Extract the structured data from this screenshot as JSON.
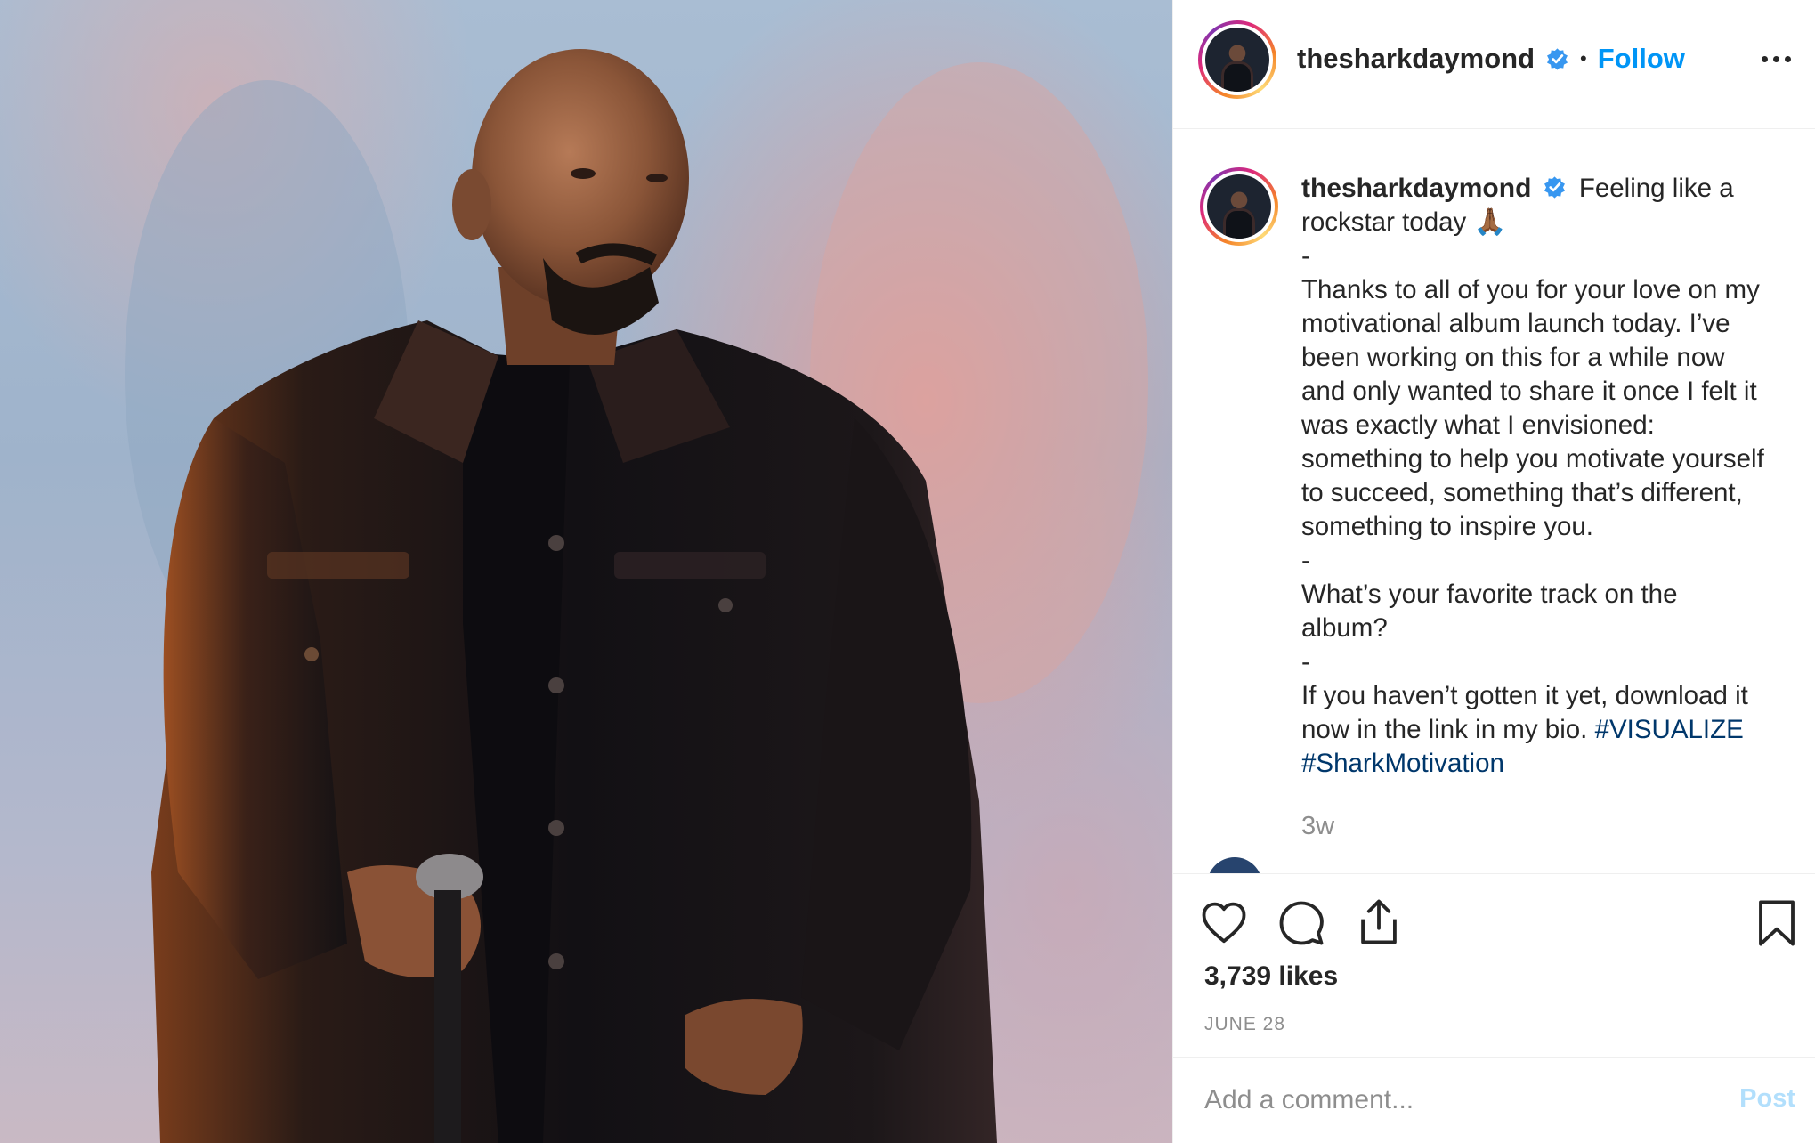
{
  "post": {
    "username": "thesharkdaymond",
    "separator": "•",
    "follow_label": "Follow",
    "caption": {
      "lines": [
        "Feeling like a",
        "rockstar today 🙏🏾",
        "-",
        "Thanks to all of you for your love on my",
        "motivational album launch today. I’ve",
        "been working on this for a while now",
        "and only wanted to share it once I felt it",
        "was exactly what I envisioned:",
        "something to help you motivate yourself",
        "to succeed, something that’s different,",
        "something to inspire you.",
        "-",
        "What’s your favorite track on the",
        "album?",
        "-",
        "If you haven’t gotten it yet, download it",
        "now in the link in my bio."
      ],
      "hashtag_1": "#VISUALIZE",
      "hashtag_2": "#SharkMotivation"
    },
    "time_ago": "3w",
    "likes": "3,739 likes",
    "date": "JUNE 28",
    "comment_placeholder": "Add a comment...",
    "post_label": "Post"
  },
  "icons": {
    "verified": "verified-badge-icon",
    "more": "more-options-icon",
    "like": "heart-icon",
    "comment": "comment-icon",
    "share": "share-icon",
    "save": "bookmark-icon"
  },
  "colors": {
    "link_blue": "#0095f6",
    "hashtag": "#00376b",
    "muted": "#8e8e8e",
    "text": "#262626",
    "post_disabled": "#b2dffc"
  }
}
